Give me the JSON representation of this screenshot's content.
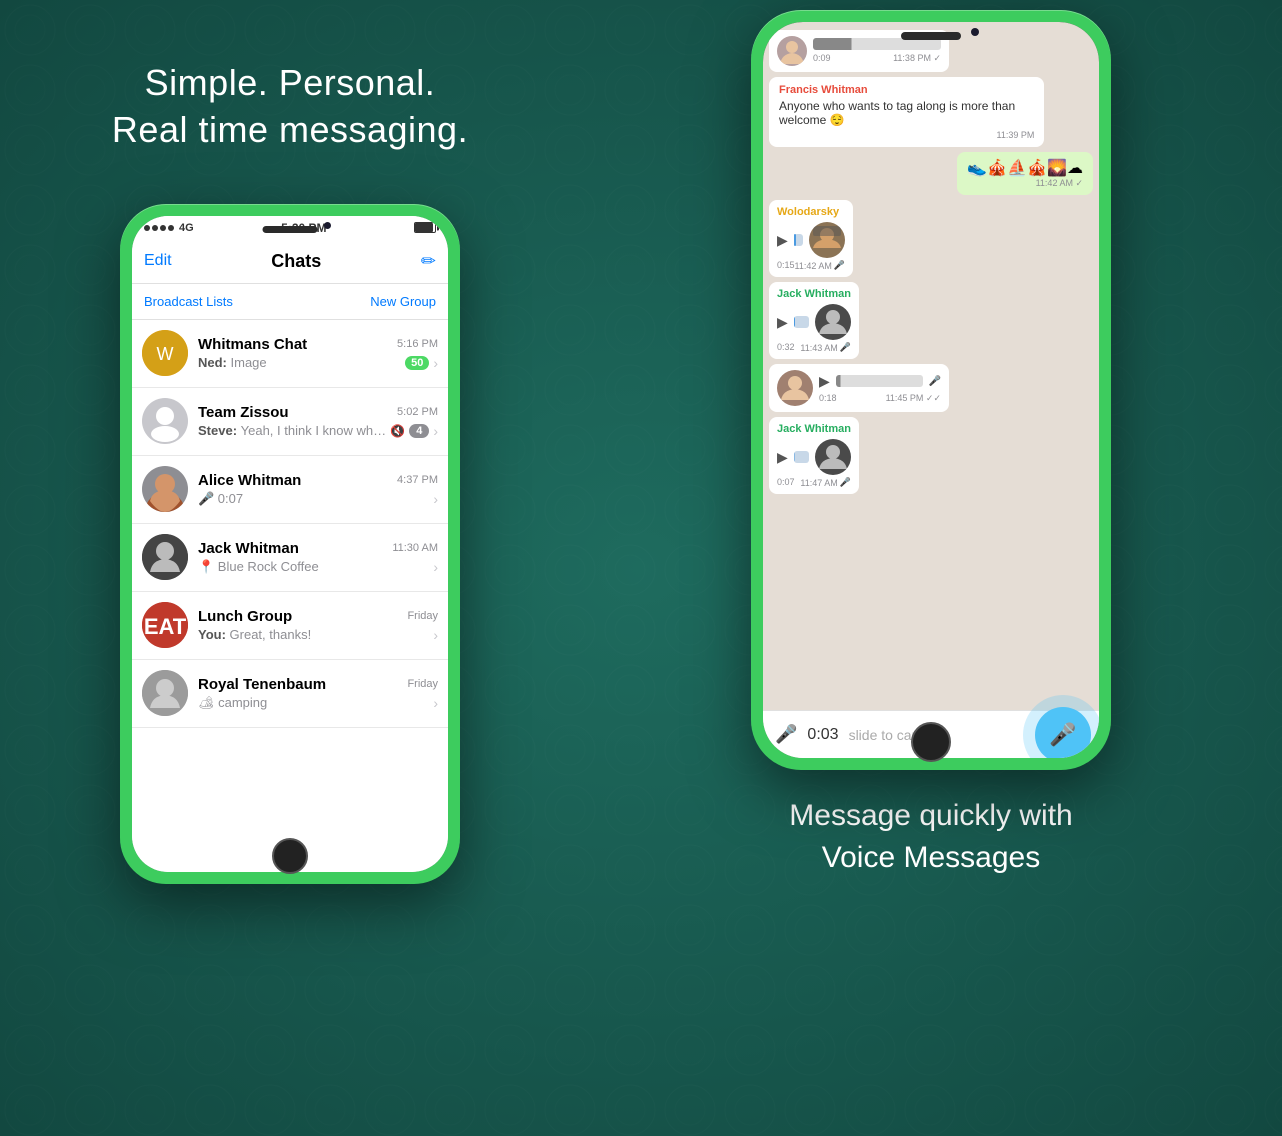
{
  "left": {
    "tagline": "Simple. Personal.\nReal time messaging.",
    "phone": {
      "status_bar": {
        "signal": "●●●●",
        "network": "4G",
        "time": "5:20 PM"
      },
      "nav": {
        "edit": "Edit",
        "title": "Chats",
        "compose_icon": "✏"
      },
      "subnav": {
        "broadcast": "Broadcast Lists",
        "new_group": "New Group"
      },
      "chats": [
        {
          "name": "Whitmans Chat",
          "time": "5:16 PM",
          "preview_label": "Ned:",
          "preview": "Image",
          "badge": "50",
          "avatar_type": "yellow"
        },
        {
          "name": "Team Zissou",
          "time": "5:02 PM",
          "preview_label": "Steve:",
          "preview": "Yeah, I think I know wha...",
          "badge": "4",
          "muted": true,
          "avatar_type": "gray"
        },
        {
          "name": "Alice Whitman",
          "time": "4:37 PM",
          "preview": "🎤 0:07",
          "avatar_type": "alice"
        },
        {
          "name": "Jack Whitman",
          "time": "11:30 AM",
          "preview": "📍 Blue Rock Coffee",
          "avatar_type": "jack"
        },
        {
          "name": "Lunch Group",
          "time": "Friday",
          "preview_label": "You:",
          "preview": "Great, thanks!",
          "avatar_type": "eat"
        },
        {
          "name": "Royal Tenenbaum",
          "time": "Friday",
          "preview": "camping",
          "avatar_type": "gray2"
        }
      ]
    }
  },
  "right": {
    "chat_messages": [
      {
        "type": "voice_received",
        "time": "11:38 PM",
        "duration": "0:09",
        "avatar_type": "woman",
        "check": "✓"
      },
      {
        "type": "text_received",
        "sender": "Francis Whitman",
        "sender_color": "#e74c3c",
        "text": "Anyone who wants to tag along is more than welcome 😌",
        "time": "11:39 PM"
      },
      {
        "type": "emoji_sent",
        "emojis": "👟🎪⛵🎪🌄☁",
        "time": "11:42 AM",
        "check": "✓"
      },
      {
        "type": "voice_received_named",
        "sender": "Wolodarsky",
        "sender_color": "#e6a817",
        "duration": "0:15",
        "time": "11:42 AM",
        "avatar_type": "wolodarsky"
      },
      {
        "type": "voice_received_named",
        "sender": "Jack Whitman",
        "sender_color": "#27ae60",
        "duration": "0:32",
        "time": "11:43 AM",
        "avatar_type": "jack2",
        "mic_color": "#4a90d9"
      },
      {
        "type": "voice_received",
        "time": "11:45 PM",
        "duration": "0:18",
        "avatar_type": "woman2",
        "check": "✓✓"
      },
      {
        "type": "voice_received_named",
        "sender": "Jack Whitman",
        "sender_color": "#27ae60",
        "duration": "0:07",
        "time": "11:47 AM",
        "avatar_type": "jack2",
        "mic_color": "#4a90d9"
      }
    ],
    "recording": {
      "time": "0:03",
      "label": "slide to cancel <"
    },
    "bottom_tagline": "Message quickly with\nVoice Messages"
  }
}
